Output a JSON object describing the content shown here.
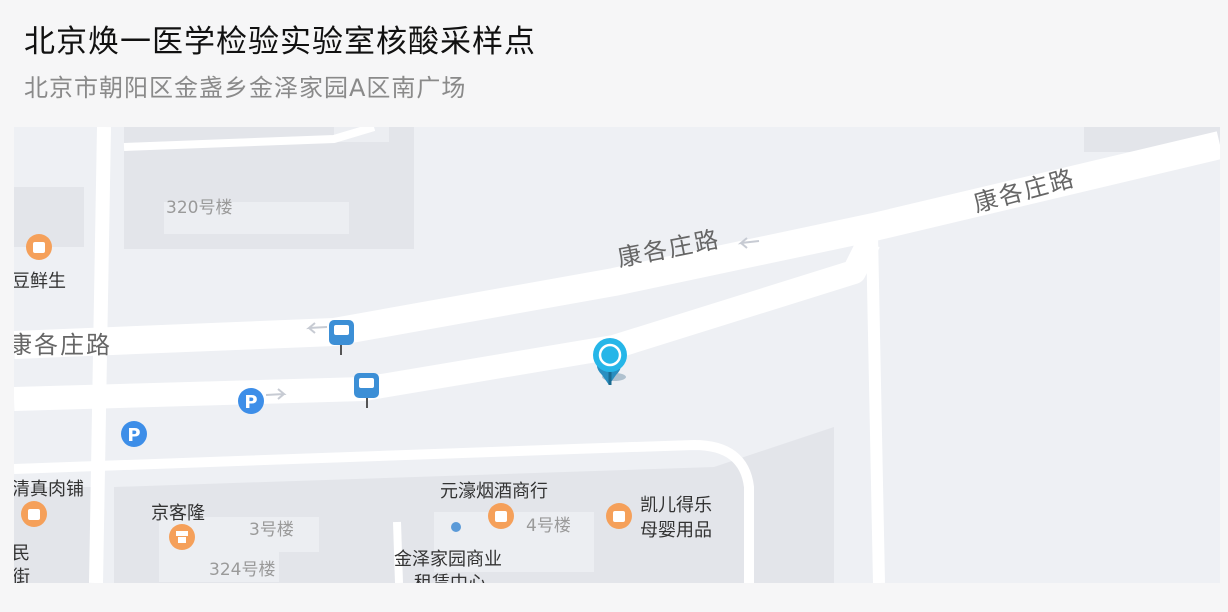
{
  "header": {
    "title": "北京焕一医学检验实验室核酸采样点",
    "address": "北京市朝阳区金盏乡金泽家园A区南广场"
  },
  "map": {
    "roads": {
      "kangge_a": "康各庄路",
      "kangge_b": "康各庄路",
      "kangge_left": "康各庄路"
    },
    "buildings": {
      "b320": "320号楼",
      "b3": "3号楼",
      "b4": "4号楼",
      "b324": "324号楼"
    },
    "pois": {
      "doudou": "豆鲜生",
      "qingzhen": "清真肉铺",
      "jingkelong": "京客隆",
      "yuanhao": "元濠烟酒商行",
      "kaier_line1": "凯儿得乐",
      "kaier_line2": "母婴用品",
      "jinze_line1": "金泽家园商业",
      "jinze_line2": "租赁中心",
      "min": "民",
      "jie": "街"
    },
    "parking_symbol": "P",
    "colors": {
      "map_bg": "#eef0f4",
      "block": "#e3e5ea",
      "road": "#ffffff",
      "poi_orange": "#f5a05a",
      "bus_blue": "#3c8fd6",
      "parking_blue": "#3d8ee8",
      "pin": "#26b6e8"
    }
  }
}
